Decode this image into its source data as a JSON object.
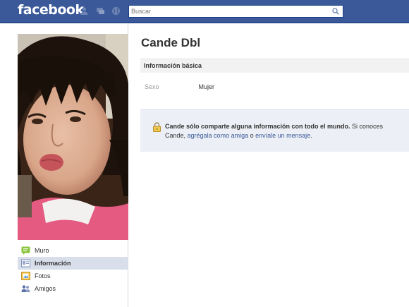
{
  "header": {
    "logo": "facebook",
    "search_placeholder": "Buscar"
  },
  "profile": {
    "name": "Cande Dbl"
  },
  "nav": {
    "items": [
      {
        "label": "Muro",
        "icon": "wall-icon"
      },
      {
        "label": "Información",
        "icon": "info-icon"
      },
      {
        "label": "Fotos",
        "icon": "photos-icon"
      },
      {
        "label": "Amigos",
        "icon": "friends-icon"
      }
    ]
  },
  "basic_info": {
    "header": "Información básica",
    "sex_label": "Sexo",
    "sex_value": "Mujer"
  },
  "notice": {
    "bold": "Cande sólo comparte alguna información con todo el mundo.",
    "text1": " Si conoces",
    "text2": "Cande, ",
    "link1": "agrégala como amiga",
    "text3": " o ",
    "link2": "envíale un mensaje",
    "text4": "."
  },
  "colors": {
    "brand_blue": "#3b5998",
    "nav_active_bg": "#d8dfea",
    "notice_bg": "#eceff5"
  }
}
